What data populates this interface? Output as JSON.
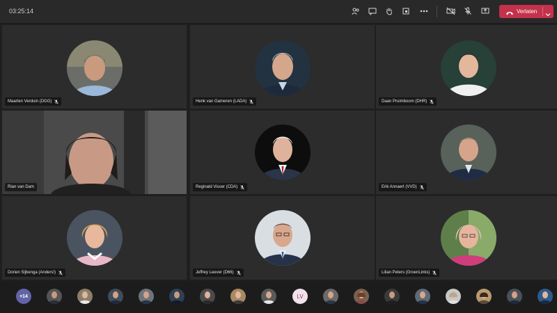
{
  "toolbar": {
    "timer": "03:25:14",
    "leave_label": "Verlaten",
    "icons": [
      "people-icon",
      "chat-icon",
      "raise-hand-icon",
      "room-view-icon",
      "more-options-icon",
      "camera-off-icon",
      "mic-off-icon",
      "share-screen-icon"
    ]
  },
  "participants": [
    {
      "name": "Maarten Verduin (DGG)"
    },
    {
      "name": "Henk van Gameren (LADA)"
    },
    {
      "name": "Daan Pruimboom (DHR)"
    },
    {
      "name": "Rian van Dam"
    },
    {
      "name": "Reginald Visser (CDA)"
    },
    {
      "name": "Erik Annaert (VVD)"
    },
    {
      "name": "Dorien Sijbenga (Anders!)"
    },
    {
      "name": "Jeffrey Leever (D66)"
    },
    {
      "name": "Lilian Peters (GroenLinks)"
    }
  ],
  "strip": {
    "overflow_count": "+14",
    "initials": "LV"
  },
  "colors": {
    "leave_red": "#c4314b",
    "accent": "#6264a7"
  }
}
